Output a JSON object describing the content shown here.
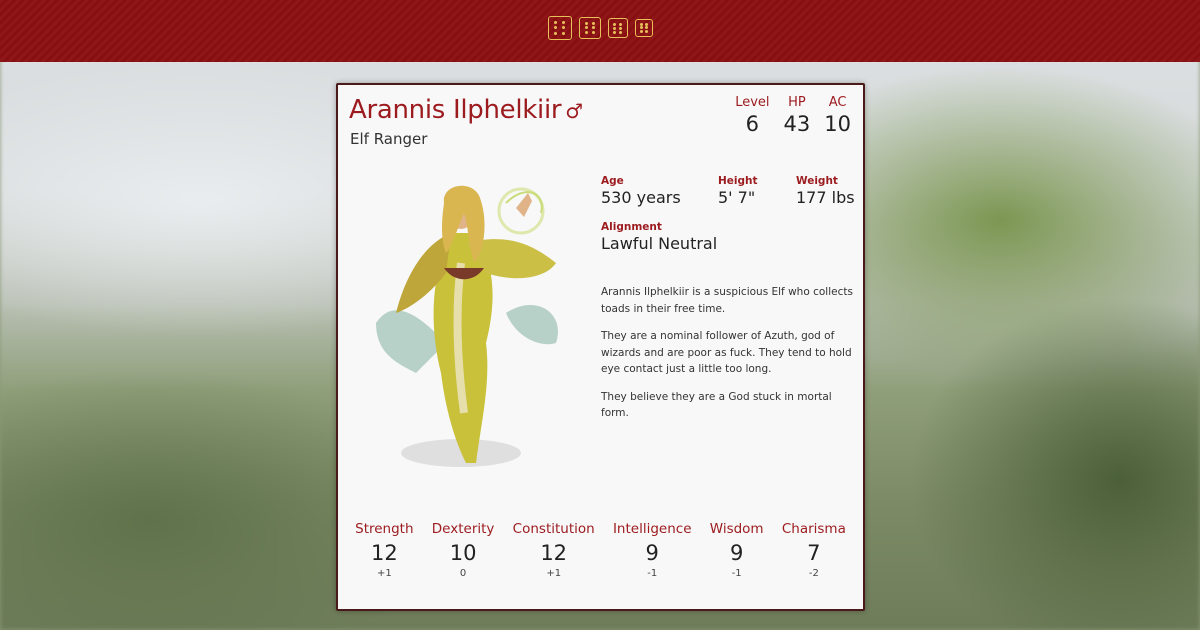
{
  "header": {
    "dice_icons": [
      "dice-icon",
      "dice-icon",
      "dice-icon",
      "dice-icon"
    ]
  },
  "character": {
    "name": "Arannis Ilphelkiir",
    "gender_symbol": "♂",
    "subtitle": "Elf Ranger",
    "stats": [
      {
        "label": "Level",
        "value": "6"
      },
      {
        "label": "HP",
        "value": "43"
      },
      {
        "label": "AC",
        "value": "10"
      }
    ],
    "attributes": {
      "age": {
        "label": "Age",
        "value": "530 years"
      },
      "height": {
        "label": "Height",
        "value": "5' 7\""
      },
      "weight": {
        "label": "Weight",
        "value": "177 lbs"
      },
      "alignment": {
        "label": "Alignment",
        "value": "Lawful Neutral"
      }
    },
    "bio": [
      "Arannis Ilphelkiir is a suspicious Elf who collects toads in their free time.",
      "They are a nominal follower of Azuth, god of wizards and are poor as fuck. They tend to hold eye contact just a little too long.",
      "They believe they are a God stuck in mortal form."
    ],
    "abilities": [
      {
        "label": "Strength",
        "score": "12",
        "mod": "+1"
      },
      {
        "label": "Dexterity",
        "score": "10",
        "mod": "0"
      },
      {
        "label": "Constitution",
        "score": "12",
        "mod": "+1"
      },
      {
        "label": "Intelligence",
        "score": "9",
        "mod": "-1"
      },
      {
        "label": "Wisdom",
        "score": "9",
        "mod": "-1"
      },
      {
        "label": "Charisma",
        "score": "7",
        "mod": "-2"
      }
    ]
  },
  "colors": {
    "header_bg": "#8b0f12",
    "accent": "#9c1b1f",
    "dice": "#e8c05a",
    "card_bg": "#f8f8f8"
  }
}
